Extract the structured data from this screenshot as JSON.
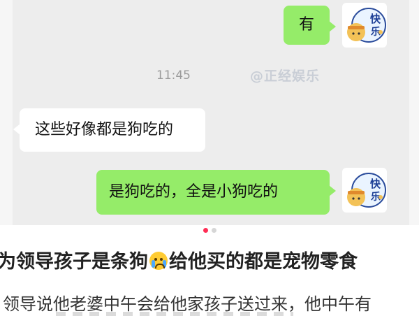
{
  "chat": {
    "messages": [
      {
        "side": "right",
        "text": "有"
      },
      {
        "side": "left",
        "text": "这些好像都是狗吃的"
      },
      {
        "side": "right",
        "text": "是狗吃的，全是小狗吃的"
      }
    ],
    "timestamp": "11:45",
    "avatar_text": "快乐"
  },
  "watermark": "@正经娱乐",
  "carousel": {
    "count": 2,
    "active": 1
  },
  "post": {
    "title_part1": "为领导孩子是条狗",
    "title_part2": "给他买的都是宠物零食",
    "emoji": "loudly-crying-face",
    "body": "领导说他老婆中午会给他家孩子送过来，他中午有"
  },
  "colors": {
    "chat_background": "#ededed",
    "bubble_green": "#95ec69",
    "bubble_white": "#ffffff",
    "carousel_active": "#ff2d55"
  }
}
